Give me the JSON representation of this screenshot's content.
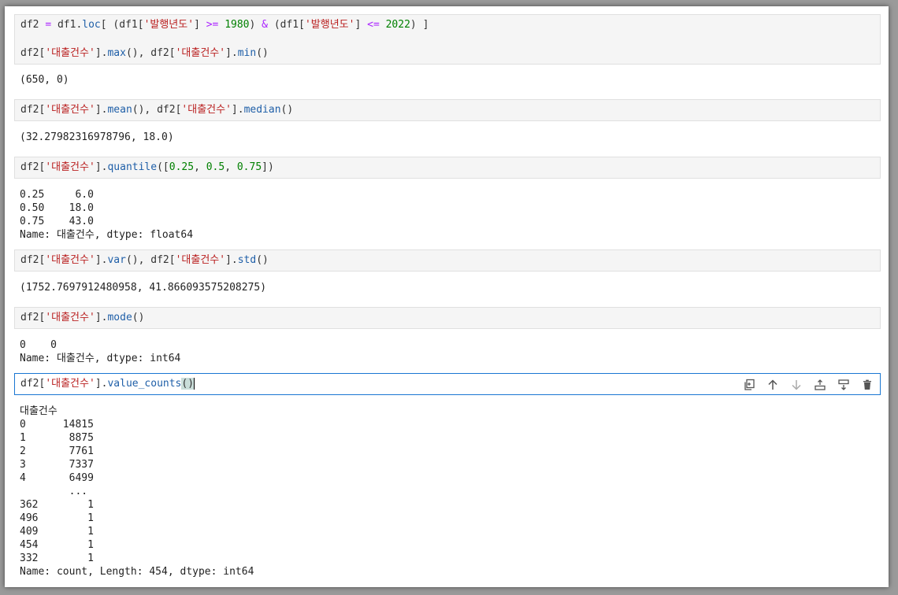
{
  "cells": [
    {
      "input_lines": [
        [
          "df2 ",
          "=",
          " df1.",
          "loc",
          "[ (df1[",
          "'발행년도'",
          "] ",
          ">=",
          " ",
          "1980",
          ") ",
          "&",
          " (df1[",
          "'발행년도'",
          "] ",
          "<=",
          " ",
          "2022",
          ") ]"
        ],
        [
          "df2[",
          "'대출건수'",
          "].",
          "max",
          "(), df2[",
          "'대출건수'",
          "].",
          "min",
          "()"
        ]
      ],
      "output_lines": [
        "(650, 0)"
      ]
    },
    {
      "input_lines": [
        [
          "df2[",
          "'대출건수'",
          "].",
          "mean",
          "(), df2[",
          "'대출건수'",
          "].",
          "median",
          "()"
        ]
      ],
      "output_lines": [
        "(32.27982316978796, 18.0)"
      ]
    },
    {
      "input_lines": [
        [
          "df2[",
          "'대출건수'",
          "].",
          "quantile",
          "([",
          "0.25",
          ", ",
          "0.5",
          ", ",
          "0.75",
          "])"
        ]
      ],
      "output_lines": [
        "0.25     6.0",
        "0.50    18.0",
        "0.75    43.0",
        "Name: 대출건수, dtype: float64"
      ]
    },
    {
      "input_lines": [
        [
          "df2[",
          "'대출건수'",
          "].",
          "var",
          "(), df2[",
          "'대출건수'",
          "].",
          "std",
          "()"
        ]
      ],
      "output_lines": [
        "(1752.7697912480958, 41.866093575208275)"
      ]
    },
    {
      "input_lines": [
        [
          "df2[",
          "'대출건수'",
          "].",
          "mode",
          "()"
        ]
      ],
      "output_lines": [
        "0    0",
        "Name: 대출건수, dtype: int64"
      ]
    },
    {
      "input_lines": [
        [
          "df2[",
          "'대출건수'",
          "].",
          "value_counts",
          "()"
        ]
      ],
      "output_lines": [
        "대출건수",
        "0      14815",
        "1       8875",
        "2       7761",
        "3       7337",
        "4       6499",
        "        ...",
        "362        1",
        "496        1",
        "409        1",
        "454        1",
        "332        1",
        "Name: count, Length: 454, dtype: int64"
      ]
    }
  ],
  "toolbar": {
    "buttons": [
      "duplicate-icon",
      "move-up-icon",
      "move-down-icon",
      "insert-above-icon",
      "insert-below-icon",
      "delete-icon"
    ]
  }
}
